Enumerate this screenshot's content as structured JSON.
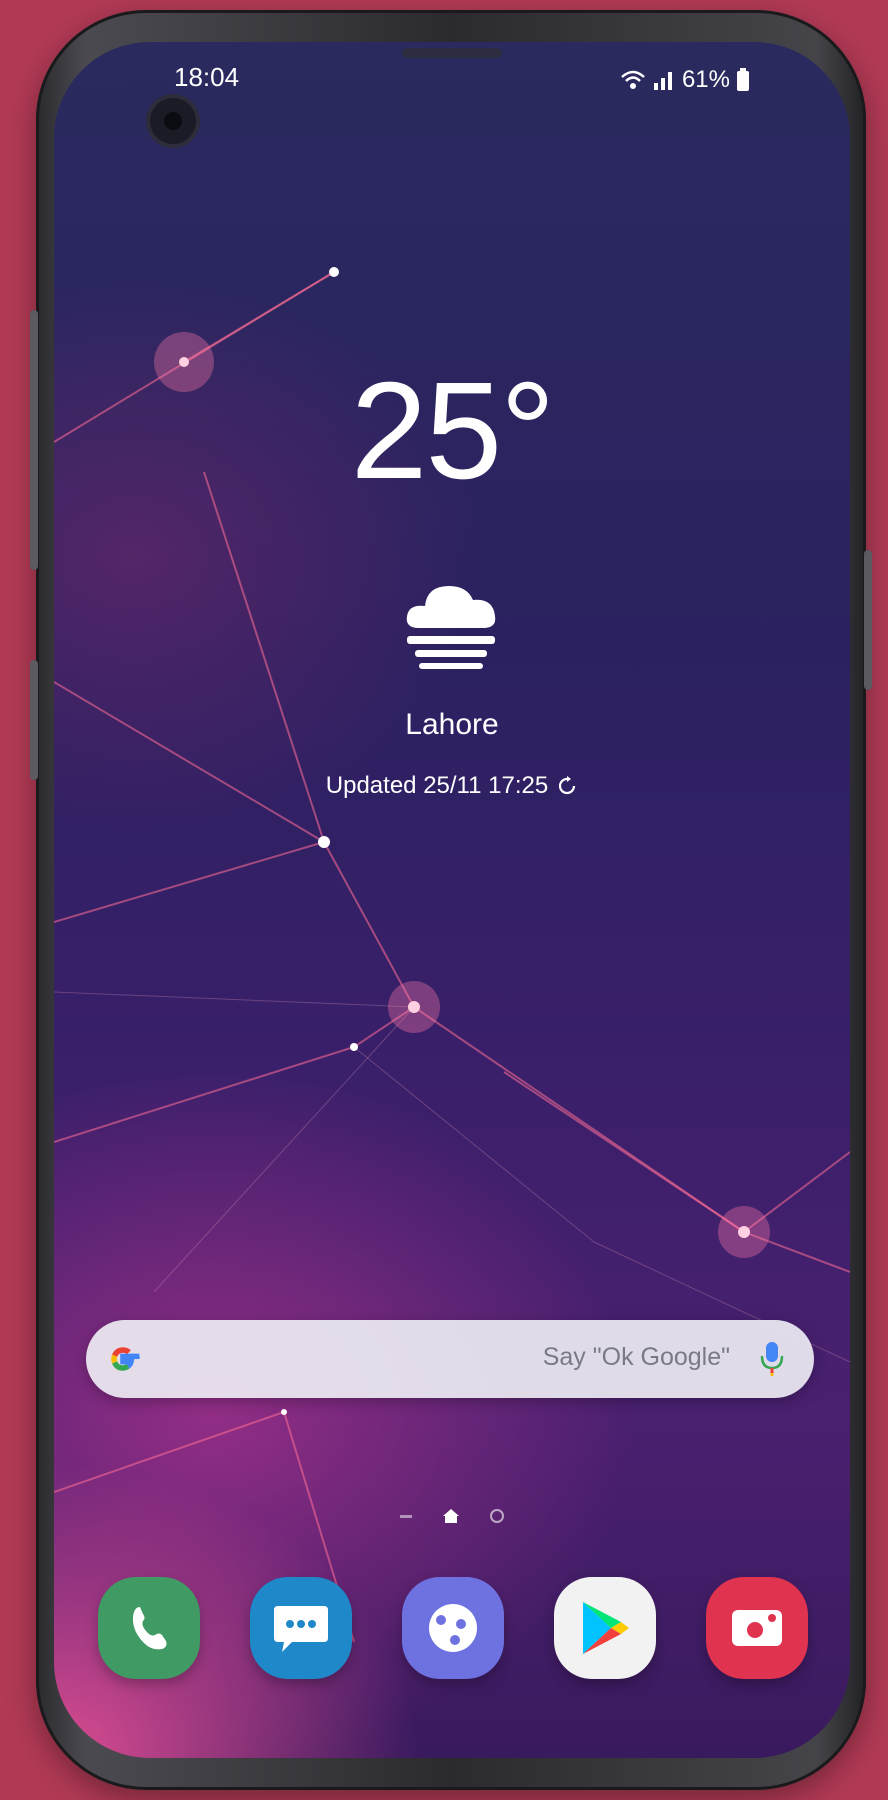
{
  "status_bar": {
    "time": "18:04",
    "battery": "61%"
  },
  "weather": {
    "temperature": "25°",
    "condition_icon": "fog-cloud-icon",
    "city": "Lahore",
    "updated": "Updated 25/11 17:25"
  },
  "search": {
    "placeholder": "Say \"Ok Google\""
  },
  "dock": {
    "apps": [
      "phone-icon",
      "messages-icon",
      "galaxy-apps-icon",
      "play-store-icon",
      "screen-recorder-icon"
    ]
  },
  "colors": {
    "background": "#b23a55",
    "phone_green": "#3f9a63",
    "messages_blue": "#1e88c8",
    "galaxy_purple": "#6e72e0",
    "playstore_bg": "#f2f2f2",
    "recorder_red": "#e0334f"
  }
}
